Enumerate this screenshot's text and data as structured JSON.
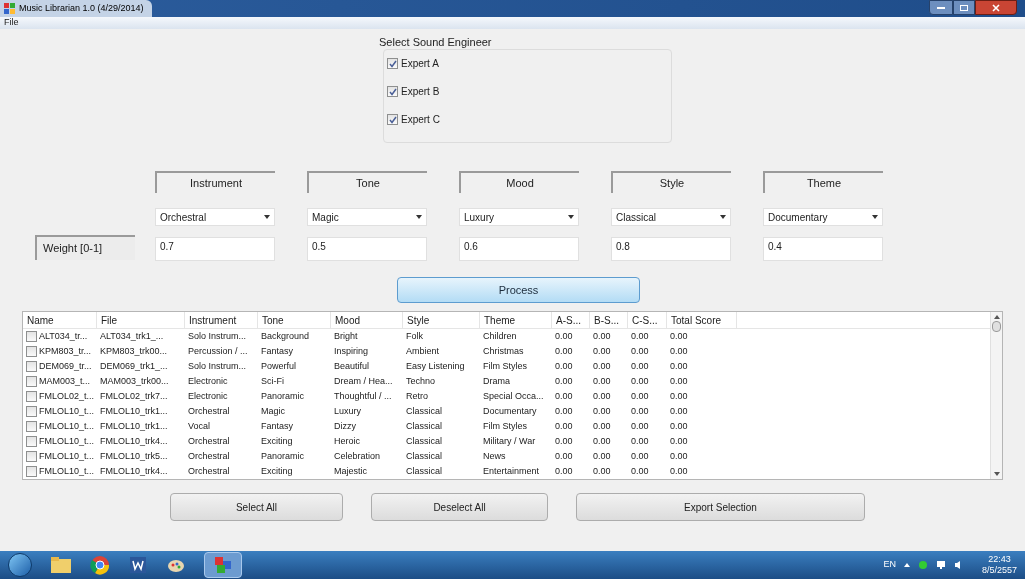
{
  "window": {
    "title": "Music Librarian 1.0 (4/29/2014)"
  },
  "menu": [
    "File"
  ],
  "engineer_group": {
    "title": "Select Sound Engineer",
    "options": [
      {
        "label": "Expert A",
        "checked": true
      },
      {
        "label": "Expert B",
        "checked": true
      },
      {
        "label": "Expert C",
        "checked": true
      }
    ]
  },
  "weight_label": "Weight [0-1]",
  "criteria": [
    {
      "header": "Instrument",
      "choice": "Orchestral",
      "weight": "0.7"
    },
    {
      "header": "Tone",
      "choice": "Magic",
      "weight": "0.5"
    },
    {
      "header": "Mood",
      "choice": "Luxury",
      "weight": "0.6"
    },
    {
      "header": "Style",
      "choice": "Classical",
      "weight": "0.8"
    },
    {
      "header": "Theme",
      "choice": "Documentary",
      "weight": "0.4"
    }
  ],
  "process_button": "Process",
  "table": {
    "columns": [
      "Name",
      "File",
      "Instrument",
      "Tone",
      "Mood",
      "Style",
      "Theme",
      "A-S...",
      "B-S...",
      "C-S...",
      "Total Score"
    ],
    "rows": [
      {
        "checked": false,
        "cells": [
          "ALT034_tr...",
          "ALT034_trk1_...",
          "Solo Instrum...",
          "Background",
          "Bright",
          "Folk",
          "Children",
          "0.00",
          "0.00",
          "0.00",
          "0.00"
        ]
      },
      {
        "checked": false,
        "cells": [
          "KPM803_tr...",
          "KPM803_trk00...",
          "Percussion / ...",
          "Fantasy",
          "Inspiring",
          "Ambient",
          "Christmas",
          "0.00",
          "0.00",
          "0.00",
          "0.00"
        ]
      },
      {
        "checked": false,
        "cells": [
          "DEM069_tr...",
          "DEM069_trk1_...",
          "Solo Instrum...",
          "Powerful",
          "Beautiful",
          "Easy Listening",
          "Film Styles",
          "0.00",
          "0.00",
          "0.00",
          "0.00"
        ]
      },
      {
        "checked": false,
        "cells": [
          "MAM003_t...",
          "MAM003_trk00...",
          "Electronic",
          "Sci-Fi",
          "Dream / Hea...",
          "Techno",
          "Drama",
          "0.00",
          "0.00",
          "0.00",
          "0.00"
        ]
      },
      {
        "checked": false,
        "cells": [
          "FMLOL02_t...",
          "FMLOL02_trk7...",
          "Electronic",
          "Panoramic",
          "Thoughtful / ...",
          "Retro",
          "Special Occa...",
          "0.00",
          "0.00",
          "0.00",
          "0.00"
        ]
      },
      {
        "checked": false,
        "cells": [
          "FMLOL10_t...",
          "FMLOL10_trk1...",
          "Orchestral",
          "Magic",
          "Luxury",
          "Classical",
          "Documentary",
          "0.00",
          "0.00",
          "0.00",
          "0.00"
        ]
      },
      {
        "checked": false,
        "cells": [
          "FMLOL10_t...",
          "FMLOL10_trk1...",
          "Vocal",
          "Fantasy",
          "Dizzy",
          "Classical",
          "Film Styles",
          "0.00",
          "0.00",
          "0.00",
          "0.00"
        ]
      },
      {
        "checked": false,
        "cells": [
          "FMLOL10_t...",
          "FMLOL10_trk4...",
          "Orchestral",
          "Exciting",
          "Heroic",
          "Classical",
          "Military / War",
          "0.00",
          "0.00",
          "0.00",
          "0.00"
        ]
      },
      {
        "checked": false,
        "cells": [
          "FMLOL10_t...",
          "FMLOL10_trk5...",
          "Orchestral",
          "Panoramic",
          "Celebration",
          "Classical",
          "News",
          "0.00",
          "0.00",
          "0.00",
          "0.00"
        ]
      },
      {
        "checked": false,
        "cells": [
          "FMLOL10_t...",
          "FMLOL10_trk4...",
          "Orchestral",
          "Exciting",
          "Majestic",
          "Classical",
          "Entertainment",
          "0.00",
          "0.00",
          "0.00",
          "0.00"
        ]
      }
    ]
  },
  "buttons": [
    "Select All",
    "Deselect All",
    "Export Selection"
  ],
  "taskbar": {
    "language": "EN",
    "time": "22:43",
    "date": "8/5/2557"
  }
}
